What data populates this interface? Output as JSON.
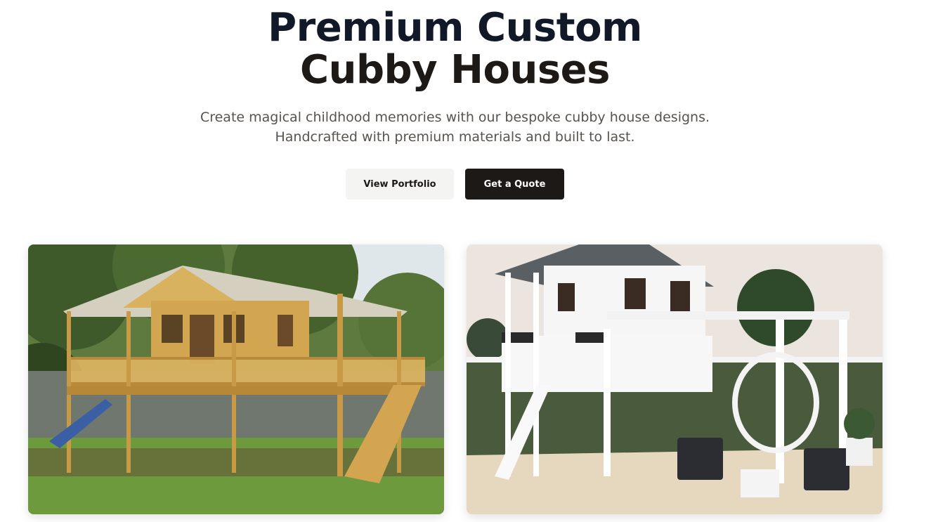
{
  "hero": {
    "title_line1": "Premium Custom",
    "title_line2": "Cubby Houses",
    "subtitle_line1": "Create magical childhood memories with our bespoke cubby house designs.",
    "subtitle_line2": "Handcrafted with premium materials and built to last."
  },
  "buttons": {
    "portfolio_label": "View Portfolio",
    "quote_label": "Get a Quote"
  },
  "gallery": {
    "images": [
      {
        "subject": "natural-timber-cubby-house-photo"
      },
      {
        "subject": "white-cubby-house-with-swing-photo"
      }
    ]
  },
  "colors": {
    "text_dark": "#1c1917",
    "title_navy": "#111827",
    "subtitle_gray": "#57534e",
    "button_light": "#f4f4f3",
    "button_dark": "#1c1917"
  }
}
